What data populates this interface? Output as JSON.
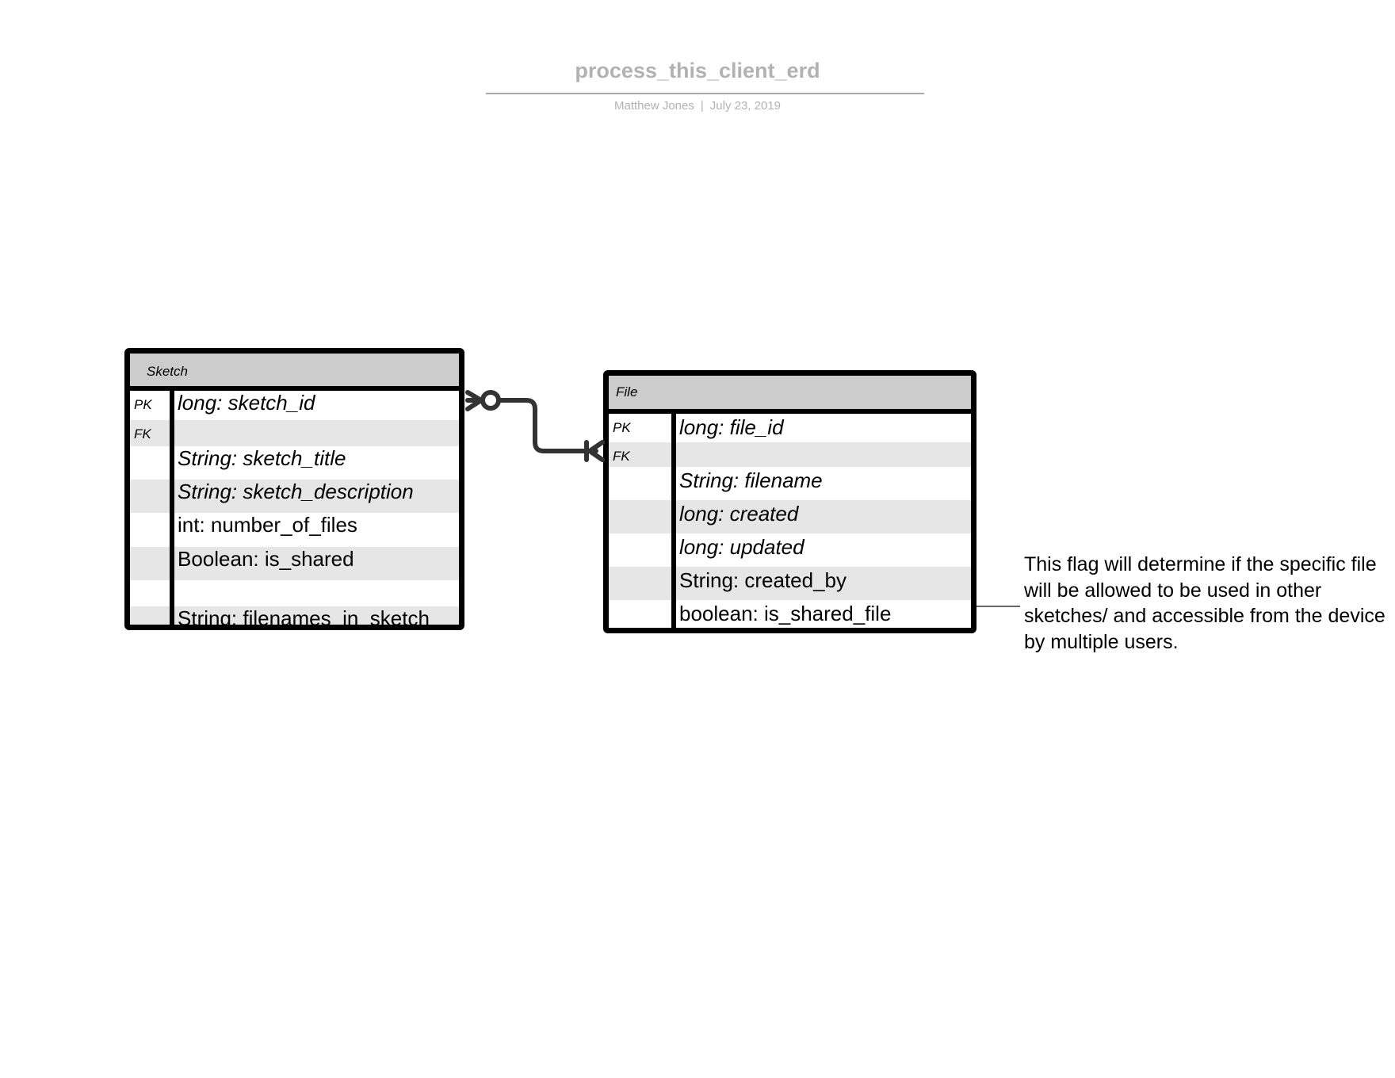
{
  "document": {
    "title": "process_this_client_erd",
    "author": "Matthew Jones",
    "separator": "|",
    "date": "July 23, 2019"
  },
  "entities": {
    "sketch": {
      "name": "Sketch",
      "rows": [
        {
          "key": "PK",
          "text": "long: sketch_id",
          "italic": true
        },
        {
          "key": "FK",
          "text": "",
          "italic": false
        },
        {
          "key": "",
          "text": "String: sketch_title",
          "italic": true
        },
        {
          "key": "",
          "text": "String: sketch_description",
          "italic": true
        },
        {
          "key": "",
          "text": "int: number_of_files",
          "italic": false
        },
        {
          "key": "",
          "text": "Boolean: is_shared",
          "italic": false
        },
        {
          "key": "",
          "text": "",
          "italic": false
        },
        {
          "key": "",
          "text": "String: filenames_in_sketch",
          "italic": false
        }
      ]
    },
    "file": {
      "name": "File",
      "rows": [
        {
          "key": "PK",
          "text": "long: file_id",
          "italic": true
        },
        {
          "key": "FK",
          "text": "",
          "italic": false
        },
        {
          "key": "",
          "text": "String: filename",
          "italic": true
        },
        {
          "key": "",
          "text": "long: created",
          "italic": true
        },
        {
          "key": "",
          "text": "long: updated",
          "italic": true
        },
        {
          "key": "",
          "text": "String: created_by",
          "italic": false
        },
        {
          "key": "",
          "text": "boolean: is_shared_file",
          "italic": false
        }
      ]
    }
  },
  "relationship": {
    "from": "Sketch",
    "to": "File",
    "from_cardinality": "zero-or-many",
    "to_cardinality": "one-or-many"
  },
  "note": {
    "text": "This flag will determine if the specific file will be allowed to be used in other sketches/ and accessible from the device by multiple users."
  }
}
